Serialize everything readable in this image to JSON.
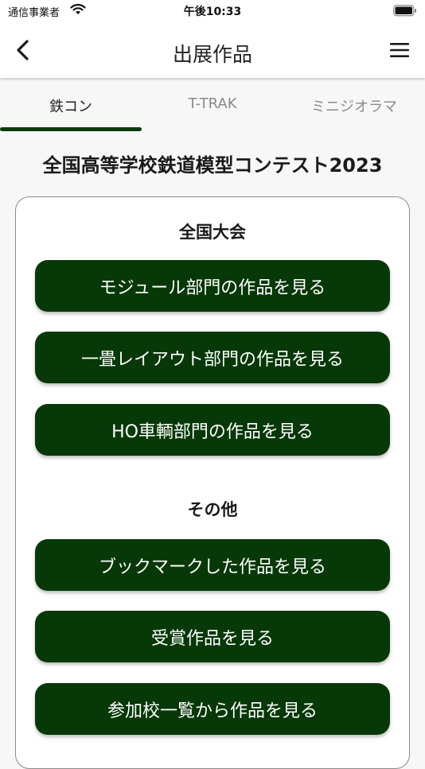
{
  "status_bar": {
    "carrier": "通信事業者",
    "time": "午後10:33"
  },
  "nav": {
    "title": "出展作品",
    "back_icon": "chevron-left-icon",
    "menu_icon": "hamburger-menu-icon"
  },
  "tabs": [
    {
      "label": "鉄コン",
      "active": true
    },
    {
      "label": "T-TRAK",
      "active": false
    },
    {
      "label": "ミニジオラマ",
      "active": false
    }
  ],
  "contest_title": "全国高等学校鉄道模型コンテスト2023",
  "sections": {
    "national": {
      "heading": "全国大会",
      "buttons": [
        "モジュール部門の作品を見る",
        "一畳レイアウト部門の作品を見る",
        "HO車輌部門の作品を見る"
      ]
    },
    "other": {
      "heading": "その他",
      "buttons": [
        "ブックマークした作品を見る",
        "受賞作品を見る",
        "参加校一覧から作品を見る"
      ]
    }
  },
  "colors": {
    "accent": "#073807",
    "tab_indicator": "#0b3b0b",
    "background": "#f7f7f7"
  }
}
